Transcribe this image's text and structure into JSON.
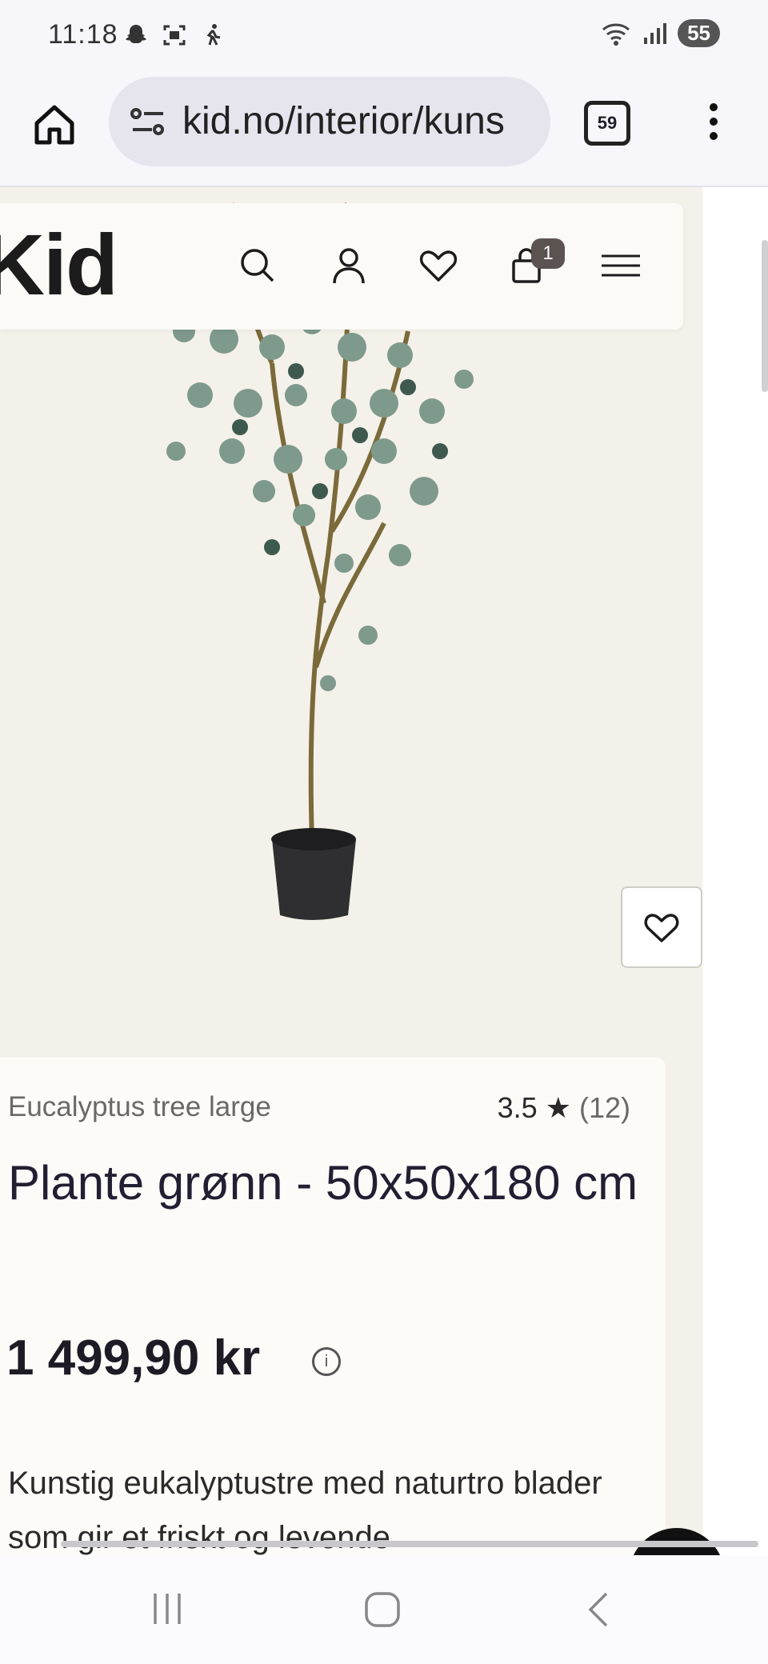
{
  "status_bar": {
    "time": "11:18",
    "battery": "55"
  },
  "browser": {
    "url": "kid.no/interior/kuns",
    "tab_count": "59"
  },
  "site_header": {
    "logo": "Kid",
    "cart_count": "1"
  },
  "product": {
    "subtitle": "Eucalyptus tree large",
    "rating": "3.5",
    "rating_star": "★",
    "review_count": "(12)",
    "title": "Plante grønn - 50x50x180 cm",
    "price": "1 499,90 kr",
    "description": "Kunstig eukalyptustre med naturtro blader som gir et friskt og levende"
  },
  "colors": {
    "page_bg": "#f4f1ea",
    "card_bg": "#fcfbf8",
    "text_dark": "#221f33",
    "badge": "#5a5350"
  }
}
